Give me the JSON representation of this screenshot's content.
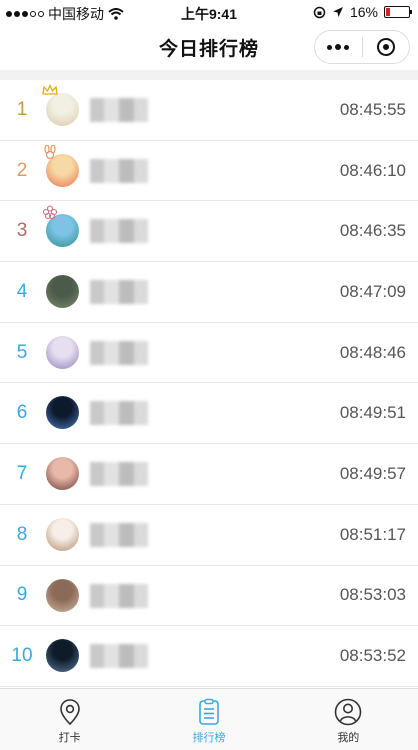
{
  "status_bar": {
    "carrier": "中国移动",
    "time": "上午9:41",
    "battery": "16%",
    "battery_level": 0.16,
    "battery_color": "#e02020"
  },
  "nav": {
    "title": "今日排行榜"
  },
  "ranking": [
    {
      "rank": "1",
      "time": "08:45:55",
      "rank_color": "#c79a3a",
      "avatar_colors": [
        "#f2efe3",
        "#d8c9a9"
      ],
      "badge": "crown"
    },
    {
      "rank": "2",
      "time": "08:46:10",
      "rank_color": "#e39a5c",
      "avatar_colors": [
        "#f7d9a5",
        "#e8704a"
      ],
      "badge": "bunny"
    },
    {
      "rank": "3",
      "time": "08:46:35",
      "rank_color": "#b56a66",
      "avatar_colors": [
        "#7cc3e6",
        "#2f8c8a"
      ],
      "badge": "flower"
    },
    {
      "rank": "4",
      "time": "08:47:09",
      "rank_color": "#3aa7df",
      "avatar_colors": [
        "#4b5a4a",
        "#7a8a6c"
      ],
      "badge": ""
    },
    {
      "rank": "5",
      "time": "08:48:46",
      "rank_color": "#3aa7df",
      "avatar_colors": [
        "#e6dff0",
        "#8e7fb8"
      ],
      "badge": ""
    },
    {
      "rank": "6",
      "time": "08:49:51",
      "rank_color": "#3aa7df",
      "avatar_colors": [
        "#0d1a2e",
        "#4b7cc0"
      ],
      "badge": ""
    },
    {
      "rank": "7",
      "time": "08:49:57",
      "rank_color": "#3aa7df",
      "avatar_colors": [
        "#e8b9a8",
        "#6b3a3a"
      ],
      "badge": ""
    },
    {
      "rank": "8",
      "time": "08:51:17",
      "rank_color": "#3aa7df",
      "avatar_colors": [
        "#f6eee7",
        "#b38a6a"
      ],
      "badge": ""
    },
    {
      "rank": "9",
      "time": "08:53:03",
      "rank_color": "#3aa7df",
      "avatar_colors": [
        "#8b6a58",
        "#d0b8a0"
      ],
      "badge": ""
    },
    {
      "rank": "10",
      "time": "08:53:52",
      "rank_color": "#3aa7df",
      "avatar_colors": [
        "#0e1c2a",
        "#5c7b9e"
      ],
      "badge": ""
    }
  ],
  "tab_bar": {
    "items": [
      {
        "label": "打卡",
        "icon": "location-pin-icon",
        "active": false
      },
      {
        "label": "排行榜",
        "icon": "list-icon",
        "active": true
      },
      {
        "label": "我的",
        "icon": "user-icon",
        "active": false
      }
    ],
    "active_color": "#3aa7df",
    "inactive_color": "#333333"
  }
}
